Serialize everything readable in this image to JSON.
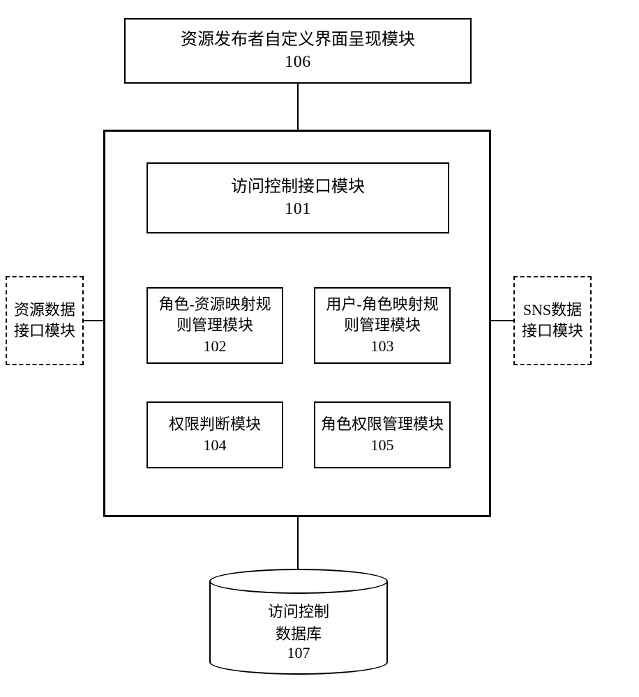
{
  "top": {
    "title": "资源发布者自定义界面呈现模块",
    "num": "106"
  },
  "center": {
    "m101": {
      "title": "访问控制接口模块",
      "num": "101"
    },
    "m102": {
      "l1": "角色-资源映射规",
      "l2": "则管理模块",
      "num": "102"
    },
    "m103": {
      "l1": "用户-角色映射规",
      "l2": "则管理模块",
      "num": "103"
    },
    "m104": {
      "title": "权限判断模块",
      "num": "104"
    },
    "m105": {
      "title": "角色权限管理模块",
      "num": "105"
    }
  },
  "left": {
    "l1": "资源数据",
    "l2": "接口模块"
  },
  "right": {
    "l1": "SNS数据",
    "l2": "接口模块"
  },
  "db": {
    "l1": "访问控制",
    "l2": "数据库",
    "num": "107"
  }
}
